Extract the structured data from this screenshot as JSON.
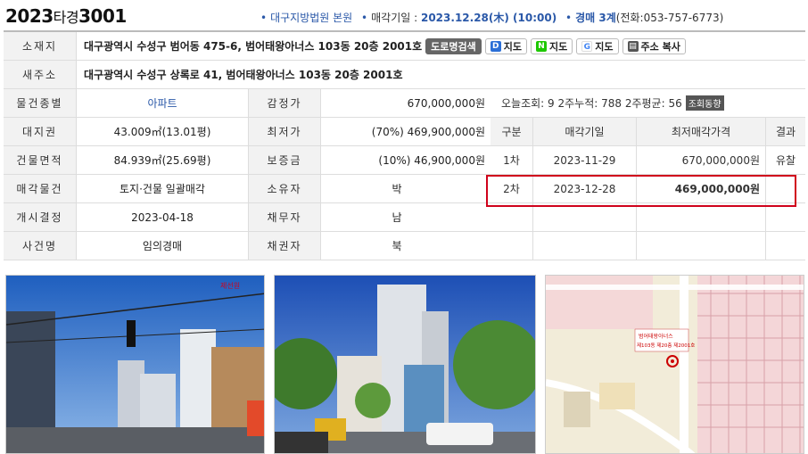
{
  "header": {
    "case_year": "2023",
    "case_type": "타경",
    "case_number": "3001",
    "court": "대구지방법원 본원",
    "sale_date_label": "매각기일 :",
    "sale_date": "2023.12.28(木) (10:00)",
    "dept": "경매 3계",
    "phone": "(전화:053-757-6773)"
  },
  "address": {
    "label": "소재지",
    "value": "대구광역시 수성구 범어동 475-6, 범어태왕아너스 103동 20층 2001호",
    "buttons": {
      "road_search": "도로명검색",
      "daum_map": "지도",
      "naver_map": "지도",
      "google_map": "지도",
      "copy_address": "주소 복사"
    }
  },
  "new_address": {
    "label": "새주소",
    "value": "대구광역시 수성구 상록로 41, 범어태왕아너스 103동 20층 2001호"
  },
  "details": {
    "type_label": "물건종별",
    "type_value": "아파트",
    "appraisal_label": "감정가",
    "appraisal_value": "670,000,000원",
    "land_label": "대지권",
    "land_value": "43.009㎡(13.01평)",
    "min_label": "최저가",
    "min_value": "(70%) 469,900,000원",
    "area_label": "건물면적",
    "area_value": "84.939㎡(25.69평)",
    "deposit_label": "보증금",
    "deposit_value": "(10%) 46,900,000원",
    "sale_item_label": "매각물건",
    "sale_item_value": "토지·건물 일괄매각",
    "owner_label": "소유자",
    "owner_value": "박",
    "start_label": "개시결정",
    "start_value": "2023-04-18",
    "debtor_label": "채무자",
    "debtor_value": "남",
    "case_name_label": "사건명",
    "case_name_value": "임의경매",
    "creditor_label": "채권자",
    "creditor_value": "북"
  },
  "stats": {
    "today_views": "오늘조회: 9",
    "two_week_total": "2주누적: 788",
    "two_week_avg": "2주평균: 56",
    "trend_button": "조회동향"
  },
  "schedule": {
    "headers": [
      "구분",
      "매각기일",
      "최저매각가격",
      "결과"
    ],
    "rows": [
      {
        "round": "1차",
        "date": "2023-11-29",
        "price": "670,000,000원",
        "result": "유찰"
      },
      {
        "round": "2차",
        "date": "2023-12-28",
        "price": "469,000,000원",
        "result": ""
      },
      {
        "round": "",
        "date": "",
        "price": "",
        "result": ""
      },
      {
        "round": "",
        "date": "",
        "price": "",
        "result": ""
      }
    ]
  },
  "photos": {
    "watermark": "제선원",
    "map_label_1": "범어태왕아너스",
    "map_label_2": "제103동 제20층 제2001호"
  },
  "colors": {
    "accent_blue": "#2a58a8",
    "highlight_red": "#d0021b",
    "label_bg": "#f2f2f2"
  }
}
